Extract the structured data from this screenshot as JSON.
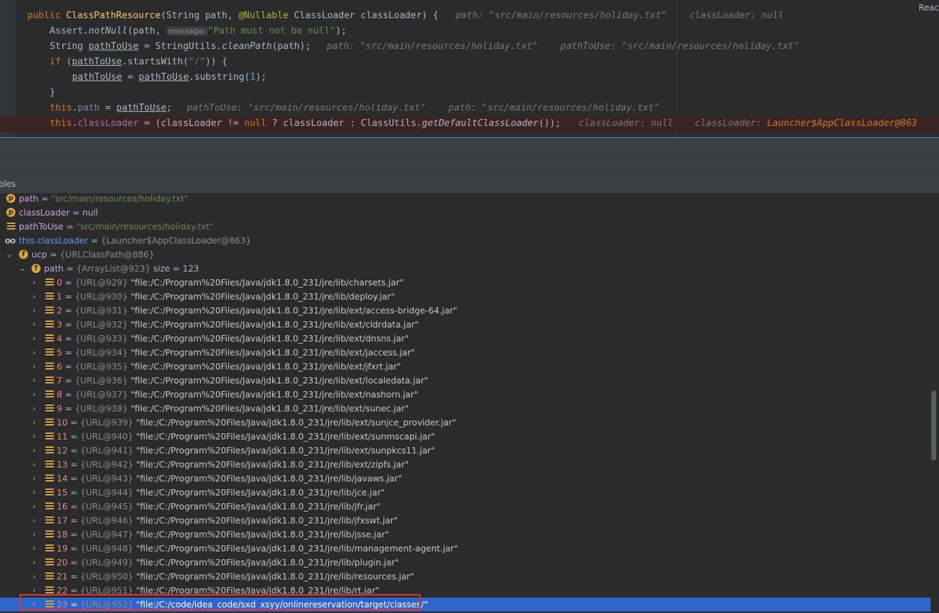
{
  "editor": {
    "read_tag": "Reac",
    "line1": {
      "kw": "public",
      "fn": "ClassPathResource",
      "p1": "(String path, ",
      "anno": "@Nullable",
      "p2": " ClassLoader classLoader) {",
      "hint1": "path: \"src/main/resources/holiday.txt\"",
      "hint2": "classLoader: null"
    },
    "line2": {
      "a": "Assert.",
      "fn": "notNull",
      "b": "(path, ",
      "param": "message:",
      "str": "\"Path must not be null\"",
      "c": ");"
    },
    "line3": {
      "a": "String ",
      "var": "pathToUse",
      "b": " = StringUtils.",
      "fn": "cleanPath",
      "c": "(path);",
      "hint1": "path: \"src/main/resources/holiday.txt\"",
      "hint2": "pathToUse: \"src/main/resources/holiday.txt\""
    },
    "line4": {
      "kw": "if",
      "a": " (",
      "var": "pathToUse",
      "b": ".startsWith(",
      "str": "\"/\"",
      "c": ")) {"
    },
    "line5": {
      "var1": "pathToUse",
      "a": " = ",
      "var2": "pathToUse",
      "b": ".substring(",
      "num": "1",
      "c": ");"
    },
    "line6": {
      "a": "}"
    },
    "line7": {
      "kw": "this",
      "a": ".",
      "field": "path",
      "b": " = ",
      "var": "pathToUse",
      "c": ";",
      "hint1": "pathToUse: \"src/main/resources/holiday.txt\"",
      "hint2": "path: \"src/main/resources/holiday.txt\""
    },
    "line8": {
      "kw": "this",
      "a": ".",
      "field": "classLoader",
      "b": " = (classLoader != ",
      "kw2": "null",
      "c": " ? classLoader : ClassUtils.",
      "fn": "getDefaultClassLoader",
      "d": "());",
      "hint1": "classLoader: null",
      "hint2_label": "classLoader: ",
      "hint2_value": "Launcher$AppClassLoader@863"
    }
  },
  "variables_panel": {
    "header": "bles"
  },
  "tree": {
    "path_var": {
      "name": "path",
      "eq": " = ",
      "value": "\"src/main/resources/holiday.txt\""
    },
    "classLoader_var": {
      "name": "classLoader",
      "eq": " = ",
      "value": "null"
    },
    "pathToUse_var": {
      "name": "pathToUse",
      "eq": " = ",
      "value": "\"src/main/resources/holiday.txt\""
    },
    "this_classLoader": {
      "name": "this.classLoader",
      "eq": " = ",
      "value": "{Launcher$AppClassLoader@863}"
    },
    "ucp": {
      "name": "ucp",
      "eq": " = ",
      "value": "{URLClassPath@886}"
    },
    "ucp_path": {
      "name": "path",
      "eq": " = ",
      "value": "{ArrayList@923}",
      "size": "size = 123"
    },
    "entries": [
      {
        "idx": "0",
        "ref": "{URL@929}",
        "url": "\"file:/C:/Program%20Files/Java/jdk1.8.0_231/jre/lib/charsets.jar\""
      },
      {
        "idx": "1",
        "ref": "{URL@930}",
        "url": "\"file:/C:/Program%20Files/Java/jdk1.8.0_231/jre/lib/deploy.jar\""
      },
      {
        "idx": "2",
        "ref": "{URL@931}",
        "url": "\"file:/C:/Program%20Files/Java/jdk1.8.0_231/jre/lib/ext/access-bridge-64.jar\""
      },
      {
        "idx": "3",
        "ref": "{URL@932}",
        "url": "\"file:/C:/Program%20Files/Java/jdk1.8.0_231/jre/lib/ext/cldrdata.jar\""
      },
      {
        "idx": "4",
        "ref": "{URL@933}",
        "url": "\"file:/C:/Program%20Files/Java/jdk1.8.0_231/jre/lib/ext/dnsns.jar\""
      },
      {
        "idx": "5",
        "ref": "{URL@934}",
        "url": "\"file:/C:/Program%20Files/Java/jdk1.8.0_231/jre/lib/ext/jaccess.jar\""
      },
      {
        "idx": "6",
        "ref": "{URL@935}",
        "url": "\"file:/C:/Program%20Files/Java/jdk1.8.0_231/jre/lib/ext/jfxrt.jar\""
      },
      {
        "idx": "7",
        "ref": "{URL@936}",
        "url": "\"file:/C:/Program%20Files/Java/jdk1.8.0_231/jre/lib/ext/localedata.jar\""
      },
      {
        "idx": "8",
        "ref": "{URL@937}",
        "url": "\"file:/C:/Program%20Files/Java/jdk1.8.0_231/jre/lib/ext/nashorn.jar\""
      },
      {
        "idx": "9",
        "ref": "{URL@938}",
        "url": "\"file:/C:/Program%20Files/Java/jdk1.8.0_231/jre/lib/ext/sunec.jar\""
      },
      {
        "idx": "10",
        "ref": "{URL@939}",
        "url": "\"file:/C:/Program%20Files/Java/jdk1.8.0_231/jre/lib/ext/sunjce_provider.jar\""
      },
      {
        "idx": "11",
        "ref": "{URL@940}",
        "url": "\"file:/C:/Program%20Files/Java/jdk1.8.0_231/jre/lib/ext/sunmscapi.jar\""
      },
      {
        "idx": "12",
        "ref": "{URL@941}",
        "url": "\"file:/C:/Program%20Files/Java/jdk1.8.0_231/jre/lib/ext/sunpkcs11.jar\""
      },
      {
        "idx": "13",
        "ref": "{URL@942}",
        "url": "\"file:/C:/Program%20Files/Java/jdk1.8.0_231/jre/lib/ext/zipfs.jar\""
      },
      {
        "idx": "14",
        "ref": "{URL@943}",
        "url": "\"file:/C:/Program%20Files/Java/jdk1.8.0_231/jre/lib/javaws.jar\""
      },
      {
        "idx": "15",
        "ref": "{URL@944}",
        "url": "\"file:/C:/Program%20Files/Java/jdk1.8.0_231/jre/lib/jce.jar\""
      },
      {
        "idx": "16",
        "ref": "{URL@945}",
        "url": "\"file:/C:/Program%20Files/Java/jdk1.8.0_231/jre/lib/jfr.jar\""
      },
      {
        "idx": "17",
        "ref": "{URL@946}",
        "url": "\"file:/C:/Program%20Files/Java/jdk1.8.0_231/jre/lib/jfxswt.jar\""
      },
      {
        "idx": "18",
        "ref": "{URL@947}",
        "url": "\"file:/C:/Program%20Files/Java/jdk1.8.0_231/jre/lib/jsse.jar\""
      },
      {
        "idx": "19",
        "ref": "{URL@948}",
        "url": "\"file:/C:/Program%20Files/Java/jdk1.8.0_231/jre/lib/management-agent.jar\""
      },
      {
        "idx": "20",
        "ref": "{URL@949}",
        "url": "\"file:/C:/Program%20Files/Java/jdk1.8.0_231/jre/lib/plugin.jar\""
      },
      {
        "idx": "21",
        "ref": "{URL@950}",
        "url": "\"file:/C:/Program%20Files/Java/jdk1.8.0_231/jre/lib/resources.jar\""
      },
      {
        "idx": "22",
        "ref": "{URL@951}",
        "url": "\"file:/C:/Program%20Files/Java/jdk1.8.0_231/jre/lib/rt.jar\""
      },
      {
        "idx": "23",
        "ref": "{URL@952}",
        "url": "\"file:/C:/code/idea_code/sxd_xsyy/onlinereservation/target/classes/\""
      }
    ]
  }
}
